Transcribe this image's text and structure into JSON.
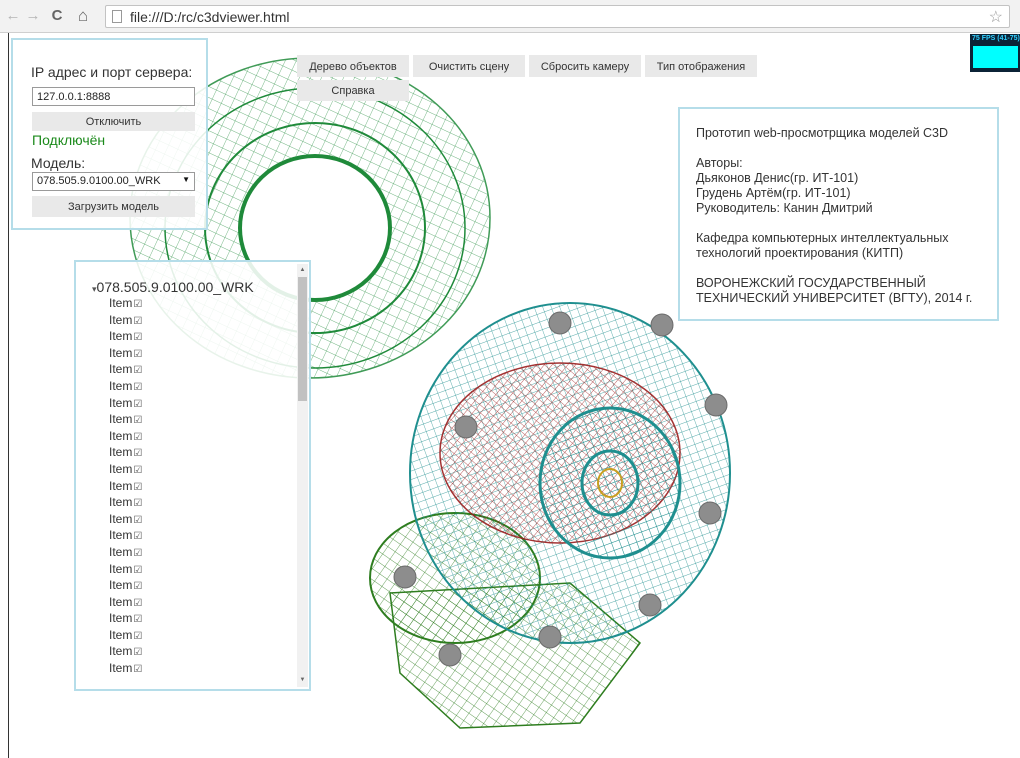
{
  "browser": {
    "back_icon": "←",
    "forward_icon": "→",
    "reload_icon": "C",
    "home_icon": "⌂",
    "url": "file:///D:/rc/c3dviewer.html",
    "bookmark_icon": "☆"
  },
  "fps": {
    "label": "75 FPS (41-75)",
    "graph_color": "#00ffff"
  },
  "connection": {
    "ip_label": "IP адрес и порт сервера:",
    "ip_value": "127.0.0.1:8888",
    "disconnect_label": "Отключить",
    "status": "Подключён",
    "status_color": "#1b8a1b",
    "model_label": "Модель:",
    "model_selected": "078.505.9.0100.00_WRK",
    "load_label": "Загрузить модель"
  },
  "toolbar": {
    "object_tree": "Дерево объектов",
    "clear_scene": "Очистить сцену",
    "reset_camera": "Сбросить камеру",
    "display_type": "Тип отображения",
    "help": "Справка"
  },
  "info": {
    "title": "Прототип web-просмотрщика моделей C3D",
    "authors_label": "Авторы:",
    "author1": "Дьяконов Денис(гр. ИТ-101)",
    "author2": "Грудень Артём(гр. ИТ-101)",
    "supervisor": "Руководитель: Канин Дмитрий",
    "department_line1": "Кафедра компьютерных интеллектуальных",
    "department_line2": "технологий проектирования (КИТП)",
    "university_line1": "ВОРОНЕЖСКИЙ ГОСУДАРСТВЕННЫЙ",
    "university_line2": "ТЕХНИЧЕСКИЙ УНИВЕРСИТЕТ (ВГТУ), 2014 г."
  },
  "tree": {
    "root_toggle": "▾",
    "root_label": "078.505.9.0100.00_WRK",
    "item_label": "Item",
    "item_count": 23
  },
  "colors": {
    "panel_border": "#b5dde9",
    "mesh_green": "#1f8a3a",
    "mesh_teal": "#1f8f8f",
    "mesh_red": "#9a1d1d"
  }
}
